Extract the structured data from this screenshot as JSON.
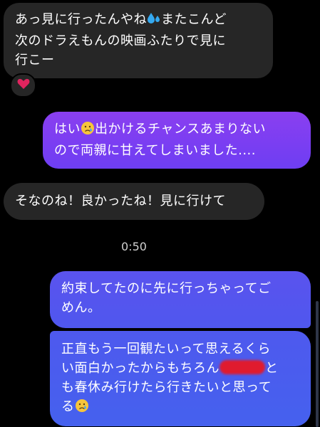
{
  "messages": {
    "m1": {
      "line1_a": "あっ見に行ったんやね",
      "line1_b": "またこんど",
      "line2": "次のドラえもんの映画ふたりで見に",
      "line3": "行こー"
    },
    "m2": {
      "line1_a": "はい",
      "line1_b": "出かけるチャンスあまりない",
      "line2": "ので両親に甘えてしまいました...."
    },
    "m3": {
      "text": "そなのね！良かったね！見に行けて"
    },
    "timestamp": "0:50",
    "m4": {
      "line1": "約束してたのに先に行っちゃってご",
      "line2": "めん。"
    },
    "m5": {
      "line1": "正直もう一回観たいって思えるくら",
      "line2_a": "い面白かったからもちろん",
      "line2_b": "と",
      "line3": "も春休み行けたら行きたいと思って",
      "line4": "る"
    }
  },
  "icons": {
    "reaction": "heart-icon",
    "sweat": "sweat-droplets-icon",
    "crying": "crying-face-icon"
  },
  "colors": {
    "incoming_bubble": "#262626",
    "outgoing_top": "#8a3ff0",
    "outgoing_bottom": "#4561ee",
    "heart": "#e0245e",
    "redaction": "#e01b2e"
  }
}
